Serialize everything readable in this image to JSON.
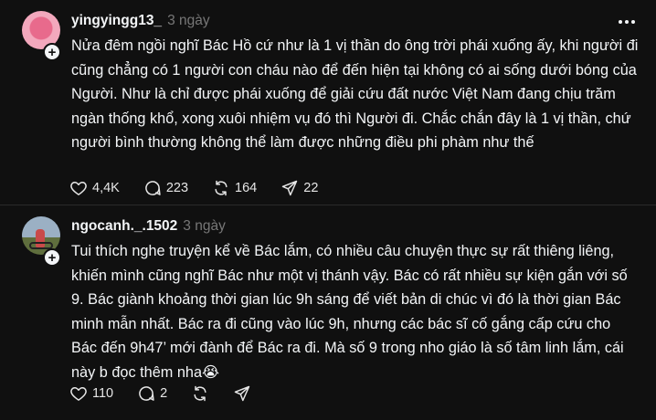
{
  "posts": [
    {
      "username": "yingyingg13_",
      "time": "3 ngày",
      "text": "Nửa đêm ngồi nghĩ Bác Hồ cứ như là 1 vị thần do ông trời phái xuống ấy, khi người đi cũng chẳng có 1 người con cháu nào để đến hiện tại không có ai sống dưới bóng của Người. Như là chỉ được phái xuống để giải cứu đất nước Việt Nam đang chịu trăm ngàn thống khổ, xong xuôi nhiệm vụ đó thì Người đi. Chắc chắn đây là 1 vị thần, chứ người bình thường không thể làm được những điều phi phàm như thế",
      "likes": "4,4K",
      "replies": "223",
      "reposts": "164",
      "shares": "22"
    },
    {
      "username": "ngocanh._.1502",
      "time": "3 ngày",
      "text": "Tui thích nghe truyện kể về Bác lắm, có nhiều câu chuyện thực sự rất thiêng liêng, khiến mình cũng nghĩ Bác như một vị thánh vậy. Bác có rất nhiều sự kiện gắn với số 9. Bác giành khoảng thời gian lúc 9h sáng để viết bản di chúc vì đó là thời gian Bác minh mẫn nhất. Bác ra đi cũng vào lúc 9h, nhưng các bác sĩ cố gắng cấp cứu cho Bác đến 9h47’ mới đành để Bác ra đi. Mà số 9 trong nho giáo là số tâm linh lắm, cái này b đọc thêm nha😭",
      "likes": "110",
      "replies": "2"
    }
  ],
  "icons": {
    "avatar_badge": "+"
  },
  "colors": {
    "background": "#101010",
    "text": "#f3f5f7",
    "muted": "#777777"
  }
}
